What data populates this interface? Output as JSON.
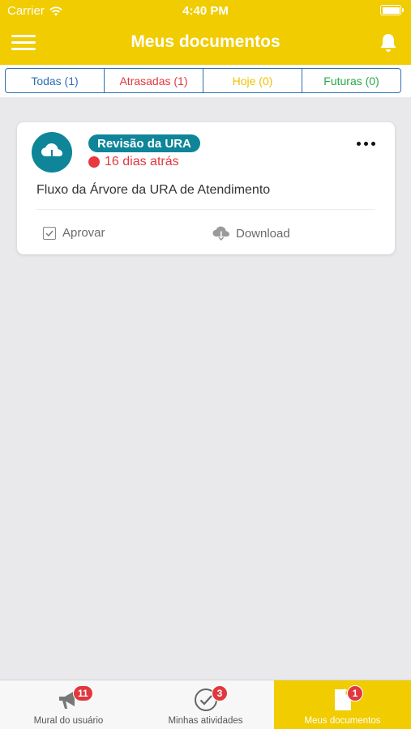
{
  "status_bar": {
    "carrier": "Carrier",
    "time": "4:40 PM"
  },
  "header": {
    "title": "Meus documentos"
  },
  "filters": [
    {
      "label": "Todas (1)",
      "color": "#2f6fb4"
    },
    {
      "label": "Atrasadas (1)",
      "color": "#e0383e"
    },
    {
      "label": "Hoje (0)",
      "color": "#f0c000"
    },
    {
      "label": "Futuras (0)",
      "color": "#2aa84a"
    }
  ],
  "document": {
    "icon": "cloud-download-icon",
    "badge": "Revisão da URA",
    "overdue": "16 dias atrás",
    "name": "Fluxo da Árvore da URA de Atendimento",
    "approve_label": "Aprovar",
    "download_label": "Download"
  },
  "tabs": [
    {
      "label": "Mural do usuário",
      "badge": "11",
      "icon": "megaphone-icon"
    },
    {
      "label": "Minhas atividades",
      "badge": "3",
      "icon": "check-circle-icon"
    },
    {
      "label": "Meus documentos",
      "badge": "1",
      "icon": "document-icon",
      "active": true
    }
  ],
  "colors": {
    "brand_yellow": "#f0cc00",
    "teal": "#0e8598",
    "alert_red": "#e0383e",
    "background": "#e9e9ec"
  }
}
